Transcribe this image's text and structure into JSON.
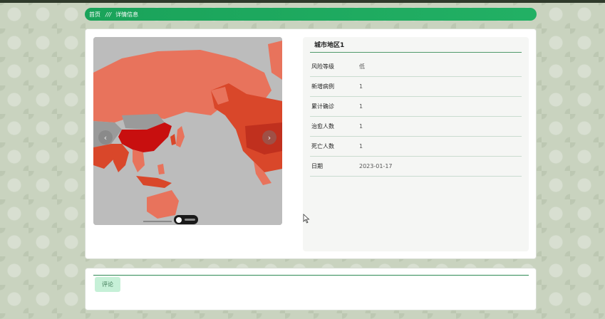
{
  "breadcrumb": {
    "home": "首页",
    "separator": "///",
    "current": "详情信息"
  },
  "map": {
    "prev_icon": "chevron-left-icon",
    "next_icon": "chevron-right-icon",
    "colors": {
      "ocean": "#bcbcbc",
      "high": "#c80f0f",
      "mid": "#d9472a",
      "low": "#e8735c",
      "none": "#9a9a9a"
    }
  },
  "detail": {
    "title": "城市地区1",
    "rows": [
      {
        "label": "风险等级",
        "value": "低"
      },
      {
        "label": "新增病例",
        "value": "1"
      },
      {
        "label": "累计确诊",
        "value": "1"
      },
      {
        "label": "治愈人数",
        "value": "1"
      },
      {
        "label": "死亡人数",
        "value": "1"
      },
      {
        "label": "日期",
        "value": "2023-01-17"
      }
    ]
  },
  "comment": {
    "tab_label": "评论"
  },
  "colors": {
    "accent": "#1aa35a",
    "divider": "#4f9a6a"
  }
}
